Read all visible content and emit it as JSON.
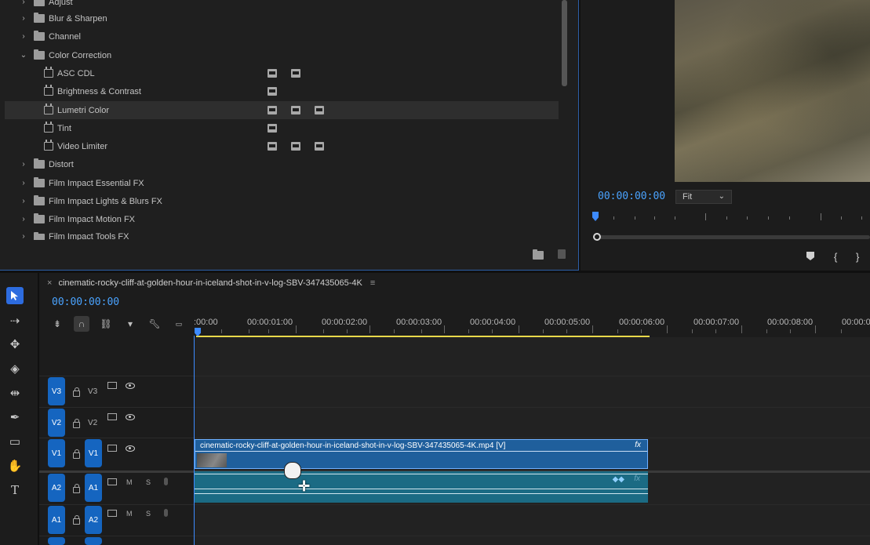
{
  "effects": {
    "items": [
      {
        "label": "Adjust",
        "kind": "folder",
        "expanded": false
      },
      {
        "label": "Blur & Sharpen",
        "kind": "folder",
        "expanded": false
      },
      {
        "label": "Channel",
        "kind": "folder",
        "expanded": false
      },
      {
        "label": "Color Correction",
        "kind": "folder",
        "expanded": true
      },
      {
        "label": "ASC CDL",
        "kind": "effect"
      },
      {
        "label": "Brightness & Contrast",
        "kind": "effect"
      },
      {
        "label": "Lumetri Color",
        "kind": "effect",
        "selected": true
      },
      {
        "label": "Tint",
        "kind": "effect"
      },
      {
        "label": "Video Limiter",
        "kind": "effect"
      },
      {
        "label": "Distort",
        "kind": "folder",
        "expanded": false
      },
      {
        "label": "Film Impact Essential FX",
        "kind": "folder",
        "expanded": false
      },
      {
        "label": "Film Impact Lights & Blurs FX",
        "kind": "folder",
        "expanded": false
      },
      {
        "label": "Film Impact Motion FX",
        "kind": "folder",
        "expanded": false
      },
      {
        "label": "Film Impact Tools FX",
        "kind": "folder",
        "expanded": false
      }
    ]
  },
  "program": {
    "timecode": "00:00:00:00",
    "fit_label": "Fit",
    "buttons": [
      "marker-icon",
      "in-point-icon",
      "out-point-icon"
    ]
  },
  "timeline": {
    "sequence_name": "cinematic-rocky-cliff-at-golden-hour-in-iceland-shot-in-v-log-SBV-347435065-4K",
    "close_glyph": "×",
    "menu_glyph": "≡",
    "timecode": "00:00:00:00",
    "ruler_labels": [
      ":00:00",
      "00:00:01:00",
      "00:00:02:00",
      "00:00:03:00",
      "00:00:04:00",
      "00:00:05:00",
      "00:00:06:00",
      "00:00:07:00",
      "00:00:08:00",
      "00:00:0"
    ],
    "tracks": [
      {
        "target": "V3",
        "name": "V3"
      },
      {
        "target": "V2",
        "name": "V2"
      },
      {
        "target": "V1",
        "name": "V1",
        "source": "V1"
      },
      {
        "target": "A2",
        "name": "A1",
        "source": "A1",
        "m": "M",
        "s": "S"
      },
      {
        "target": "A1",
        "name": "A2",
        "source": "A2",
        "m": "M",
        "s": "S"
      }
    ],
    "video_clip": {
      "name": "cinematic-rocky-cliff-at-golden-hour-in-iceland-shot-in-v-log-SBV-347435065-4K.mp4 [V]",
      "fx": "fx"
    },
    "audio_clip": {
      "fx": "fx",
      "kf": "◆◆"
    }
  },
  "colors": {
    "accent": "#3d8bff",
    "track_target": "#1565c0",
    "video_clip": "#1f5f9c",
    "audio_clip": "#1b6b84",
    "work_area": "#e8d84a"
  }
}
